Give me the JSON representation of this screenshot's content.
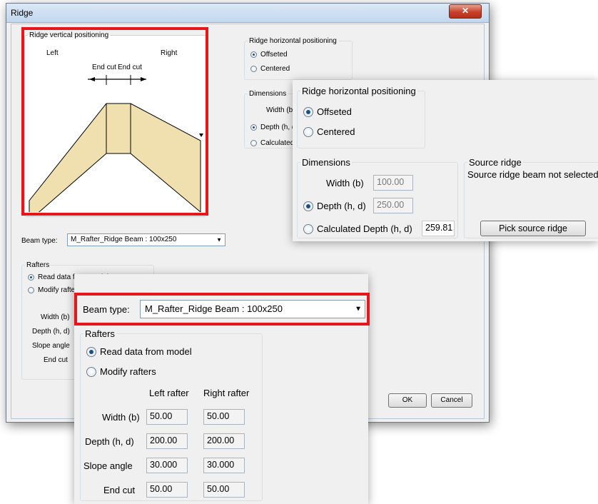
{
  "window": {
    "title": "Ridge",
    "close_glyph": "✕"
  },
  "vertical": {
    "legend": "Ridge vertical positioning",
    "left": "Left",
    "right": "Right",
    "end_cut_1": "End cut",
    "end_cut_2": "End cut",
    "fill_color": "#f0e0b0",
    "highlight_color": "#e8151b"
  },
  "horizontal": {
    "legend": "Ridge horizontal positioning",
    "options": [
      "Offseted",
      "Centered"
    ],
    "selected": "Offseted"
  },
  "dimensions": {
    "legend": "Dimensions",
    "width_label": "Width (b)",
    "width_value": "100.00",
    "depth_label": "Depth (h, d)",
    "depth_value": "250.00",
    "calc_label": "Calculated Depth (h, d)",
    "calc_value": "259.81",
    "calc_label_cut": "Calculated Dep",
    "selected": "Depth (h, d)"
  },
  "source": {
    "legend": "Source ridge",
    "status": "Source ridge beam not selected",
    "pick_label": "Pick source ridge"
  },
  "beam": {
    "label": "Beam type:",
    "value": "M_Rafter_Ridge Beam : 100x250"
  },
  "rafters": {
    "legend": "Rafters",
    "options": [
      "Read data from model",
      "Modify rafters"
    ],
    "selected": "Read data from model",
    "col_left": "Left rafter",
    "col_right": "Right rafter",
    "rows": [
      {
        "label": "Width (b)",
        "left": "50.00",
        "right": "50.00"
      },
      {
        "label": "Depth (h, d)",
        "left": "200.00",
        "right": "200.00"
      },
      {
        "label": "Slope angle",
        "left": "30.000",
        "right": "30.000"
      },
      {
        "label": "End cut",
        "left": "50.00",
        "right": "50.00"
      }
    ],
    "cut_values": [
      "2",
      "2",
      "3",
      "5"
    ]
  },
  "buttons": {
    "ok": "OK",
    "cancel": "Cancel"
  }
}
